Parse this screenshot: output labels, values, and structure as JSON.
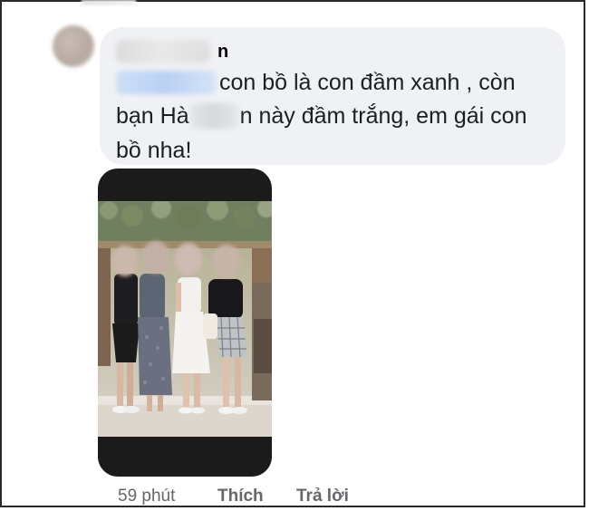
{
  "comment": {
    "author_visible_suffix": "n",
    "lines": {
      "line1": "con bồ là con đầm xanh , còn",
      "line2_prefix": "bạn Hà",
      "line2_suffix": "n này đầm trắng, em gái con",
      "line3": "bồ nha!"
    },
    "photo_icon": "photo-attachment"
  },
  "actions": {
    "time": "59 phút",
    "like": "Thích",
    "reply": "Trả lời"
  },
  "colors": {
    "bubble": "#eff1f4",
    "text": "#1c1e21",
    "meta": "#65676b"
  }
}
